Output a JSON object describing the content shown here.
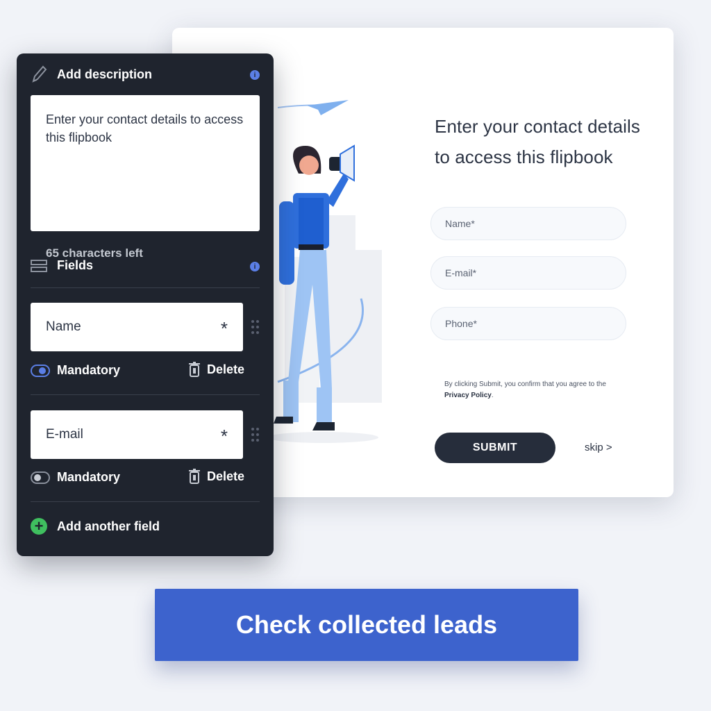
{
  "form": {
    "title": "Enter your contact details to access this flipbook",
    "fields": [
      {
        "placeholder": "Name*"
      },
      {
        "placeholder": "E-mail*"
      },
      {
        "placeholder": "Phone*"
      }
    ],
    "consent_prefix": "By clicking Submit, you confirm that you agree to the ",
    "privacy_link": "Privacy Policy",
    "consent_suffix": ".",
    "submit_label": "SUBMIT",
    "skip_label": "skip >"
  },
  "panel": {
    "description_heading": "Add description",
    "description_text": "Enter your contact details to access this flipbook",
    "chars_left": "65 characters left",
    "fields_heading": "Fields",
    "info_icon": "i",
    "items": [
      {
        "name": "Name",
        "required_mark": "*",
        "mandatory_label": "Mandatory",
        "mandatory": true,
        "delete_label": "Delete"
      },
      {
        "name": "E-mail",
        "required_mark": "*",
        "mandatory_label": "Mandatory",
        "mandatory": false,
        "delete_label": "Delete"
      }
    ],
    "add_field_label": "Add another field",
    "add_icon": "+"
  },
  "cta": {
    "label": "Check collected leads"
  },
  "colors": {
    "accent": "#3d63cd",
    "panel": "#1f242e",
    "add": "#3fbf5f",
    "submit": "#262d3b"
  },
  "icons": [
    "pencil-icon",
    "info-icon",
    "fields-icon",
    "drag-handle-icon",
    "trash-icon",
    "plus-circle-icon"
  ]
}
